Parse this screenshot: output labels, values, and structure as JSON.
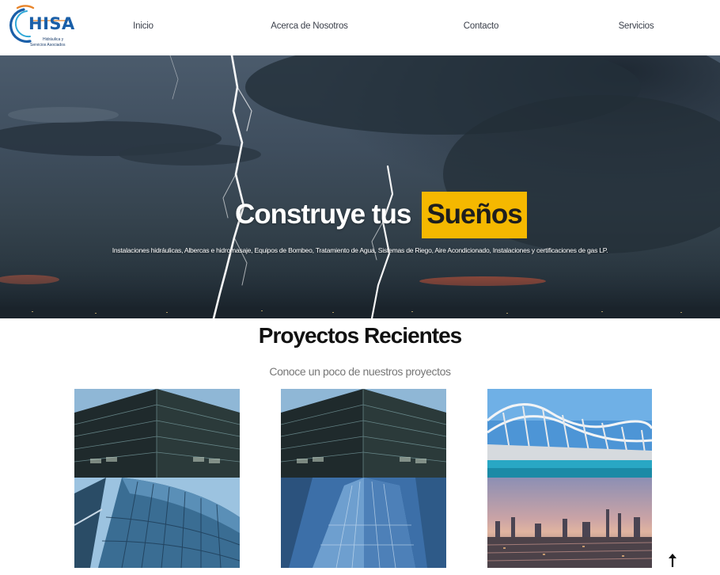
{
  "logo": {
    "brand": "HISA",
    "tagline_line1": "Hidráulica y",
    "tagline_line2": "Servicios Asociados",
    "colors": {
      "blue": "#1a5fa8",
      "orange": "#e8842a",
      "cyan": "#2fa8d8"
    }
  },
  "nav": {
    "items": [
      {
        "label": "Inicio"
      },
      {
        "label": "Acerca de Nosotros"
      },
      {
        "label": "Contacto"
      },
      {
        "label": "Servicios"
      }
    ]
  },
  "hero": {
    "title_plain": "Construye tus",
    "title_highlight": "Sueños",
    "highlight_color": "#f5b800",
    "subtitle": "Instalaciones hidráulicas, Albercas e hidromasaje, Equipos de Bombeo, Tratamiento de Agua, Sistemas de Riego, Aire Acondicionado, Instalaciones y certificaciones de gas LP."
  },
  "projects": {
    "title": "Proyectos Recientes",
    "subtitle": "Conoce un poco de nuestros proyectos",
    "tiles": [
      {
        "icon": "skyscraper-upward-image"
      },
      {
        "icon": "skyscraper-upward-image"
      },
      {
        "icon": "white-arched-building-image"
      },
      {
        "icon": "glass-curved-building-image"
      },
      {
        "icon": "glass-tower-image"
      },
      {
        "icon": "city-harbor-dusk-image"
      }
    ]
  },
  "scroll_top": {
    "icon": "arrow-up-icon"
  }
}
